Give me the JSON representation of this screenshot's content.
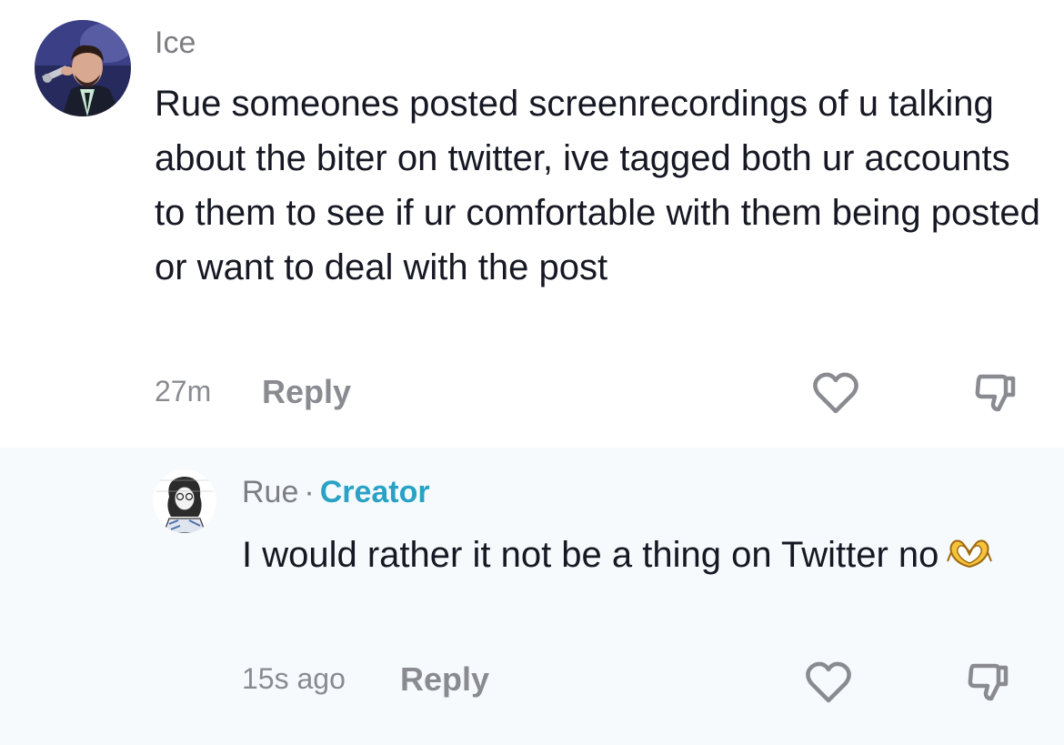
{
  "comments": [
    {
      "username": "Ice",
      "text": "Rue someones posted screenrecordings of u talking about the biter on twitter, ive tagged both ur accounts to them to see if ur comfortable with them being posted or want to deal with the post",
      "time": "27m",
      "reply_label": "Reply",
      "avatar_icon": "user-avatar-photo",
      "like_icon": "heart-outline-icon",
      "dislike_icon": "thumbs-down-icon"
    },
    {
      "username": "Rue",
      "separator": "·",
      "badge": "Creator",
      "text": "I would rather it not be a thing on Twitter no",
      "emoji": "heart-hands-emoji",
      "time": "15s ago",
      "reply_label": "Reply",
      "avatar_icon": "user-avatar-drawing",
      "like_icon": "heart-outline-icon",
      "dislike_icon": "thumbs-down-icon"
    }
  ],
  "colors": {
    "creator_badge": "#2aa2c6",
    "muted_text": "#7d7d84",
    "reply_background": "#f6fafc",
    "body_text": "#161823"
  }
}
